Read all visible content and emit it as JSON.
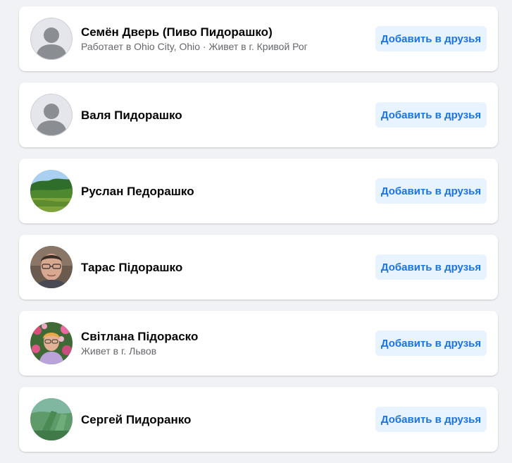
{
  "people": [
    {
      "name": "Семён Дверь (Пиво Пидорашко)",
      "subtitle": "Работает в Ohio City, Ohio · Живет в г. Кривой Рог",
      "avatar": "default-avatar-icon",
      "button_label": "Добавить в друзья"
    },
    {
      "name": "Валя Пидорашко",
      "subtitle": "",
      "avatar": "default-avatar-icon",
      "button_label": "Добавить в друзья"
    },
    {
      "name": "Руслан Педорашко",
      "subtitle": "",
      "avatar": "landscape-photo",
      "button_label": "Добавить в друзья"
    },
    {
      "name": "Тарас Підорашко",
      "subtitle": "",
      "avatar": "man-portrait-photo",
      "button_label": "Добавить в друзья"
    },
    {
      "name": "Світлана Підораско",
      "subtitle": "Живет в г. Львов",
      "avatar": "woman-with-flowers-photo",
      "button_label": "Добавить в друзья"
    },
    {
      "name": "Сергей Пидоранко",
      "subtitle": "",
      "avatar": "green-field-photo",
      "button_label": "Добавить в друзья"
    }
  ],
  "colors": {
    "page_background": "#f0f2f5",
    "card_background": "#ffffff",
    "button_background": "#e7f3ff",
    "button_text": "#1b74e4",
    "name_text": "#050505",
    "subtitle_text": "#65676b"
  }
}
